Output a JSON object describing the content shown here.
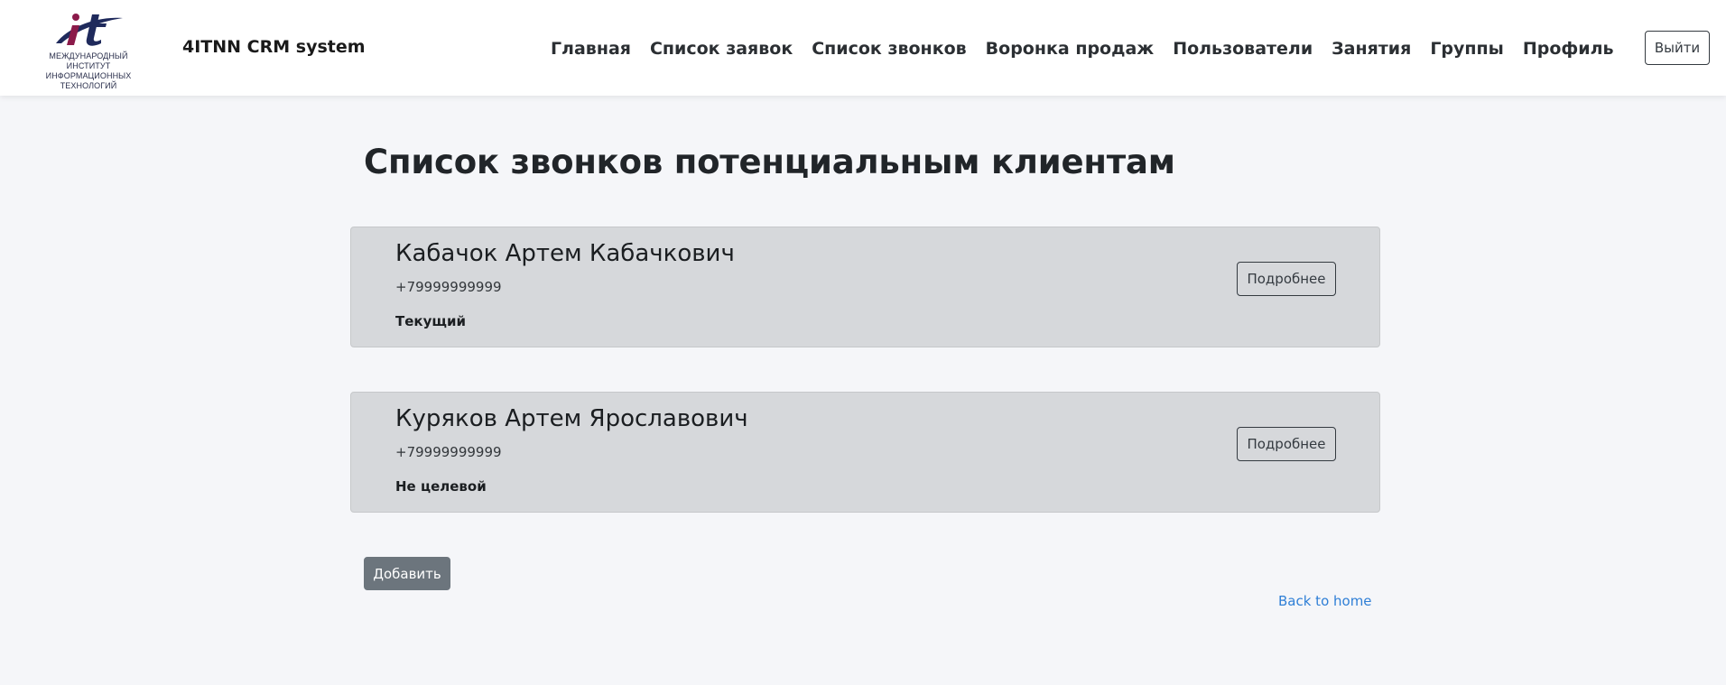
{
  "header": {
    "logo_text": "МЕЖДУНАРОДНЫЙ ИНСТИТУТ ИНФОРМАЦИОННЫХ ТЕХНОЛОГИЙ",
    "logo_letters": "it",
    "brand": "4ITNN CRM system",
    "nav": [
      {
        "label": "Главная"
      },
      {
        "label": "Список заявок"
      },
      {
        "label": "Список звонков"
      },
      {
        "label": "Воронка продаж"
      },
      {
        "label": "Пользователи"
      },
      {
        "label": "Занятия"
      },
      {
        "label": "Группы"
      },
      {
        "label": "Профиль"
      }
    ],
    "logout_label": "Выйти"
  },
  "main": {
    "title": "Список звонков потенциальным клиентам",
    "calls": [
      {
        "name": "Кабачок Артем Кабачкович",
        "phone": "+79999999999",
        "status": "Текущий",
        "details_label": "Подробнее"
      },
      {
        "name": "Куряков Артем Ярославович",
        "phone": "+79999999999",
        "status": "Не целевой",
        "details_label": "Подробнее"
      }
    ],
    "add_label": "Добавить",
    "back_label": "Back to home"
  },
  "colors": {
    "logo_maroon": "#8b1a4a",
    "logo_navy": "#1f2a5c",
    "card_bg": "#d6d8db",
    "secondary_button": "#6c757d",
    "link": "#2f7fd6"
  }
}
